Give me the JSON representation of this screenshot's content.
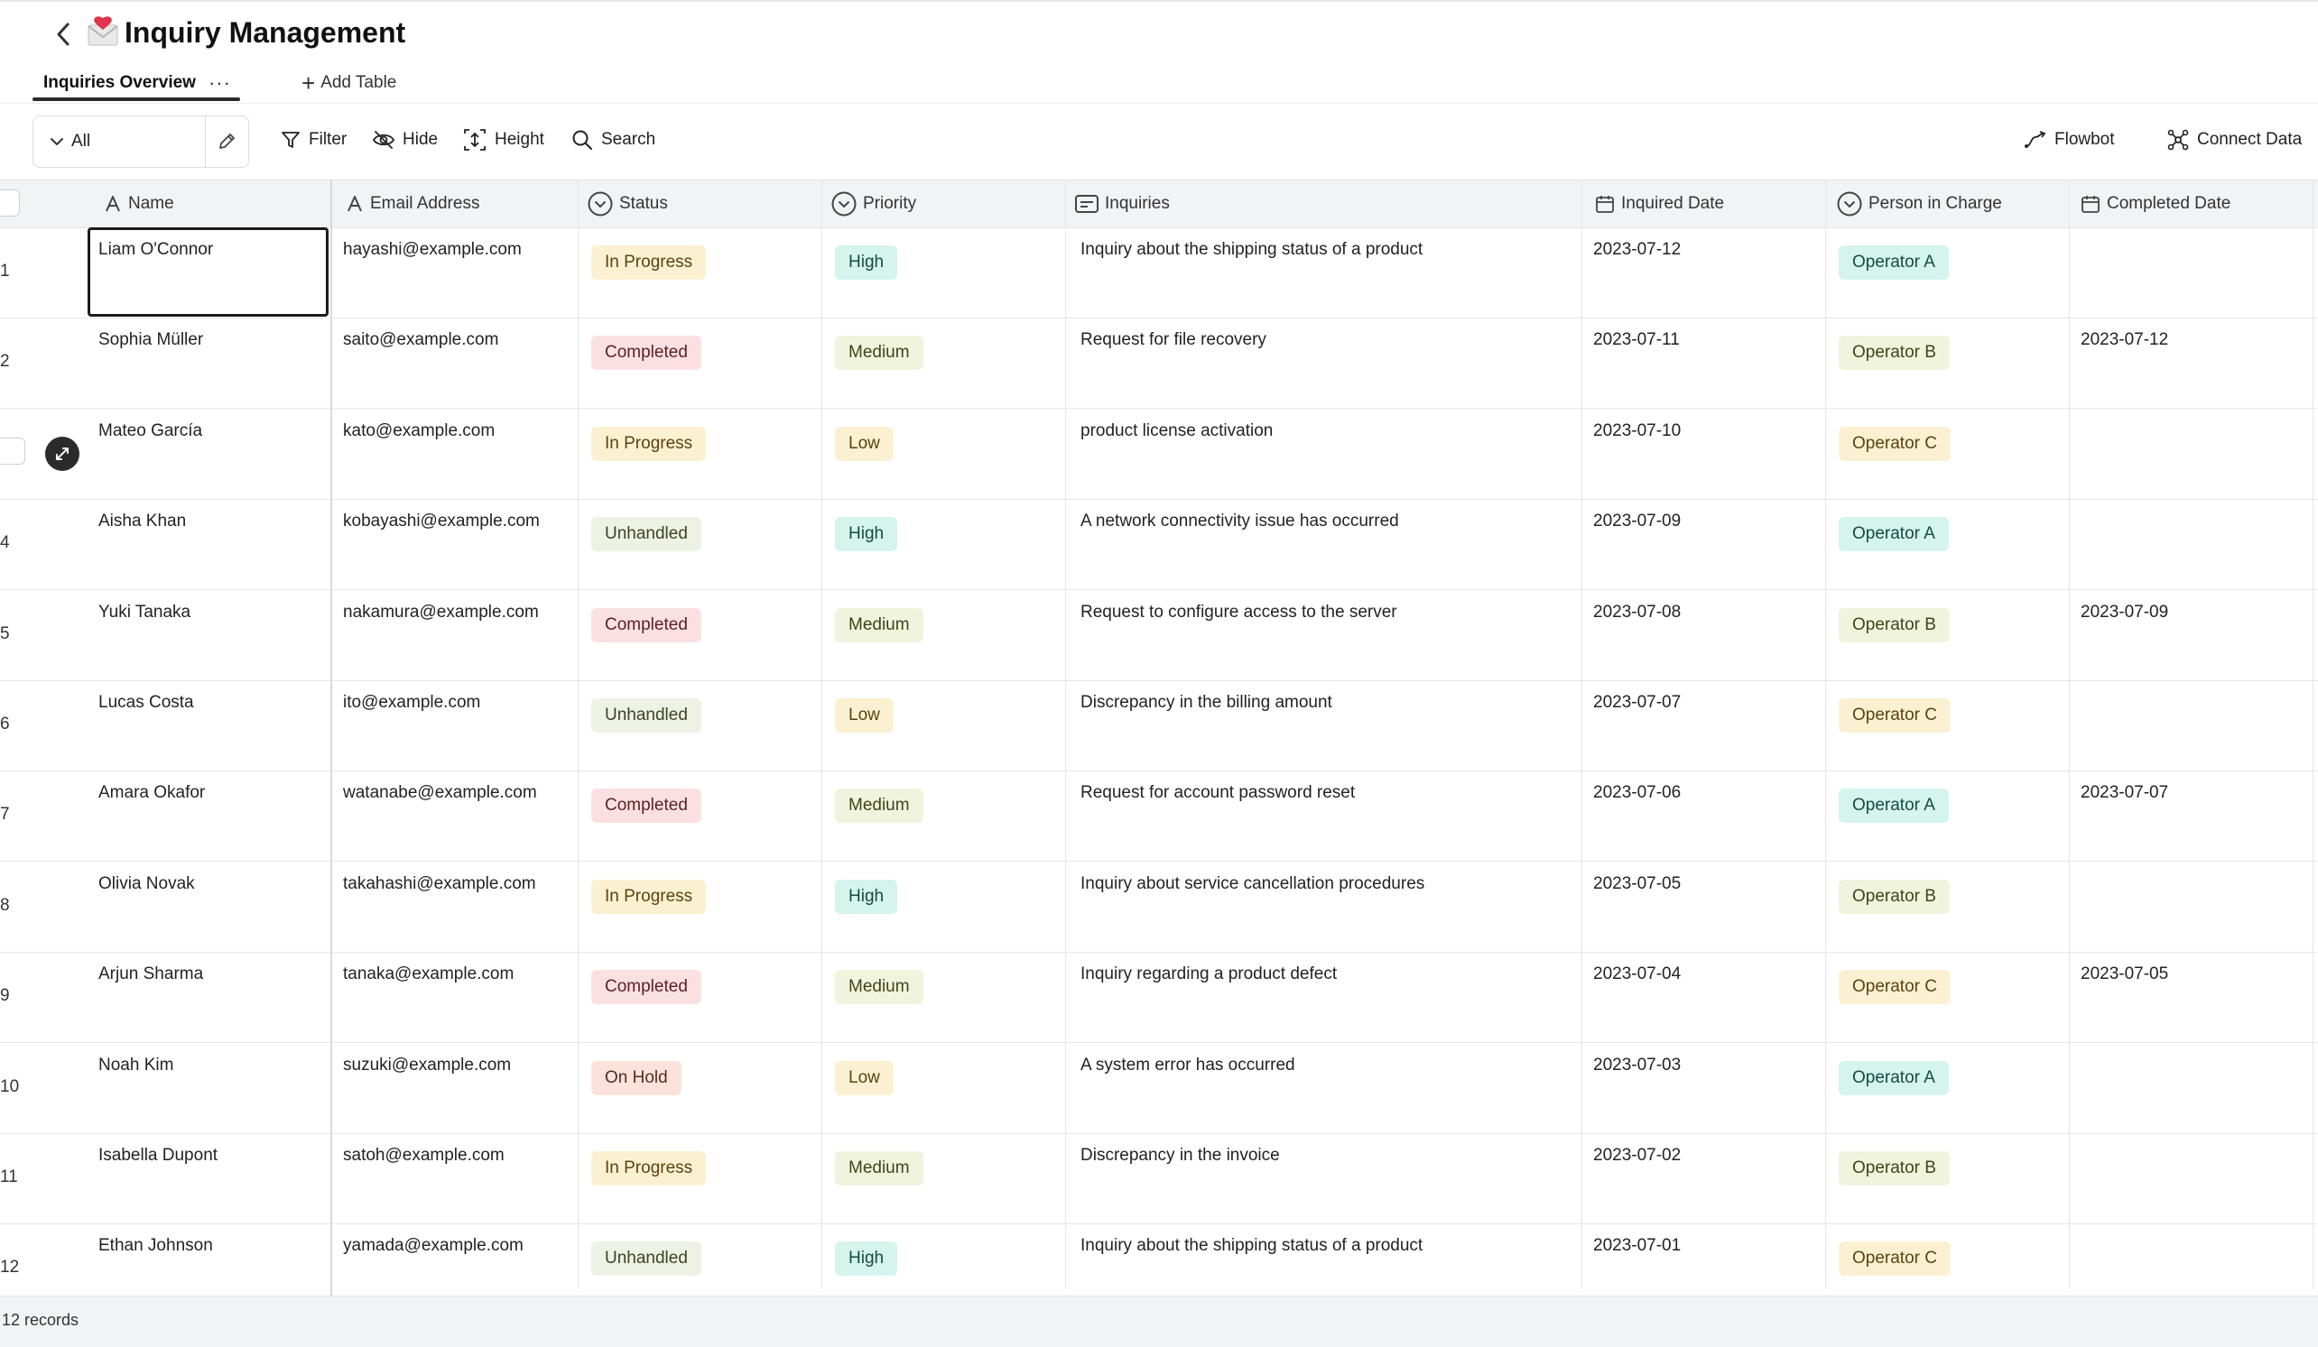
{
  "header": {
    "title": "Inquiry Management",
    "icon": "envelope-emoji",
    "active_tab": "Inquiries Overview",
    "tab_more": "···",
    "add_table": "Add Table"
  },
  "toolbar": {
    "view": "All",
    "filter": "Filter",
    "hide": "Hide",
    "height": "Height",
    "search": "Search",
    "flowbot": "Flowbot",
    "connect_data": "Connect Data"
  },
  "columns": {
    "name": "Name",
    "email": "Email Address",
    "status": "Status",
    "priority": "Priority",
    "inquiries": "Inquiries",
    "inquired_date": "Inquired Date",
    "person": "Person in Charge",
    "completed_date": "Completed Date"
  },
  "rows": [
    {
      "num": "1",
      "name": "Liam O'Connor",
      "email": "hayashi@example.com",
      "status": "In Progress",
      "priority": "High",
      "inquiry": "Inquiry about the shipping status of a product",
      "date": "2023-07-12",
      "person": "Operator A",
      "completed": ""
    },
    {
      "num": "2",
      "name": "Sophia Müller",
      "email": "saito@example.com",
      "status": "Completed",
      "priority": "Medium",
      "inquiry": "Request for file recovery",
      "date": "2023-07-11",
      "person": "Operator B",
      "completed": "2023-07-12"
    },
    {
      "num": "",
      "name": "Mateo García",
      "email": "kato@example.com",
      "status": "In Progress",
      "priority": "Low",
      "inquiry": "product license activation",
      "date": "2023-07-10",
      "person": "Operator C",
      "completed": ""
    },
    {
      "num": "4",
      "name": "Aisha Khan",
      "email": "kobayashi@example.com",
      "status": "Unhandled",
      "priority": "High",
      "inquiry": "A network connectivity issue has occurred",
      "date": "2023-07-09",
      "person": "Operator A",
      "completed": ""
    },
    {
      "num": "5",
      "name": "Yuki Tanaka",
      "email": "nakamura@example.com",
      "status": "Completed",
      "priority": "Medium",
      "inquiry": "Request to configure access to the server",
      "date": "2023-07-08",
      "person": "Operator B",
      "completed": "2023-07-09"
    },
    {
      "num": "6",
      "name": "Lucas Costa",
      "email": "ito@example.com",
      "status": "Unhandled",
      "priority": "Low",
      "inquiry": "Discrepancy in the billing amount",
      "date": "2023-07-07",
      "person": "Operator C",
      "completed": ""
    },
    {
      "num": "7",
      "name": "Amara Okafor",
      "email": "watanabe@example.com",
      "status": "Completed",
      "priority": "Medium",
      "inquiry": "Request for account password reset",
      "date": "2023-07-06",
      "person": "Operator A",
      "completed": "2023-07-07"
    },
    {
      "num": "8",
      "name": "Olivia Novak",
      "email": "takahashi@example.com",
      "status": "In Progress",
      "priority": "High",
      "inquiry": "Inquiry about service cancellation procedures",
      "date": "2023-07-05",
      "person": "Operator B",
      "completed": ""
    },
    {
      "num": "9",
      "name": "Arjun Sharma",
      "email": "tanaka@example.com",
      "status": "Completed",
      "priority": "Medium",
      "inquiry": "Inquiry regarding a product defect",
      "date": "2023-07-04",
      "person": "Operator C",
      "completed": "2023-07-05"
    },
    {
      "num": "10",
      "name": "Noah Kim",
      "email": "suzuki@example.com",
      "status": "On Hold",
      "priority": "Low",
      "inquiry": "A system error has occurred",
      "date": "2023-07-03",
      "person": "Operator A",
      "completed": ""
    },
    {
      "num": "11",
      "name": "Isabella Dupont",
      "email": "satoh@example.com",
      "status": "In Progress",
      "priority": "Medium",
      "inquiry": "Discrepancy in the invoice",
      "date": "2023-07-02",
      "person": "Operator B",
      "completed": ""
    },
    {
      "num": "12",
      "name": "Ethan Johnson",
      "email": "yamada@example.com",
      "status": "Unhandled",
      "priority": "High",
      "inquiry": "Inquiry about the shipping status of a product",
      "date": "2023-07-01",
      "person": "Operator C",
      "completed": ""
    }
  ],
  "footer": {
    "count": "12 records"
  }
}
